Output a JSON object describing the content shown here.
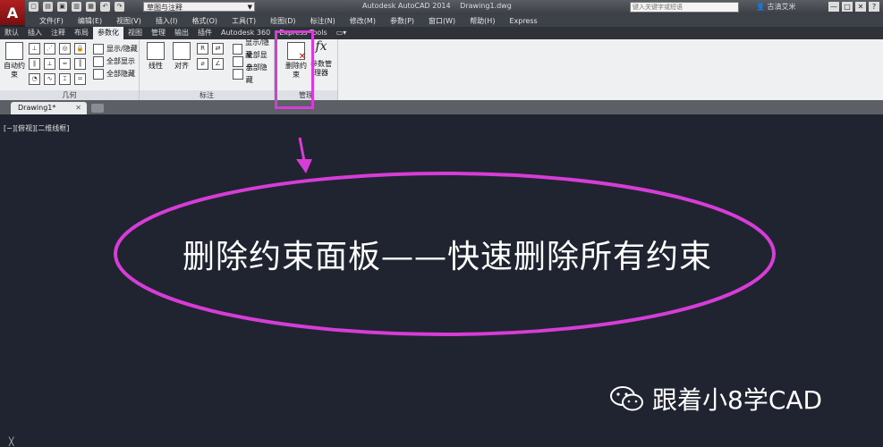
{
  "titlebar": {
    "app_letter": "A",
    "workspace": "草图与注释",
    "title_app": "Autodesk AutoCAD 2014",
    "title_file": "Drawing1.dwg",
    "search_placeholder": "键入关键字或短语",
    "user": "古滇艾米",
    "window_controls": [
      "—",
      "□",
      "✕"
    ],
    "help": "?"
  },
  "menubar": {
    "items": [
      "文件(F)",
      "编辑(E)",
      "视图(V)",
      "插入(I)",
      "格式(O)",
      "工具(T)",
      "绘图(D)",
      "标注(N)",
      "修改(M)",
      "参数(P)",
      "窗口(W)",
      "帮助(H)",
      "Express"
    ]
  },
  "ribbon_tabs": {
    "items": [
      "默认",
      "插入",
      "注释",
      "布局",
      "参数化",
      "视图",
      "管理",
      "输出",
      "插件",
      "Autodesk 360",
      "Express Tools"
    ],
    "active_index": 4
  },
  "ribbon": {
    "geometry": {
      "title": "几何",
      "auto_constrain": "自动约束",
      "show_hide": "显示/隐藏",
      "show_all": "全部显示",
      "hide_all": "全部隐藏"
    },
    "dimension": {
      "title": "标注",
      "linear": "线性",
      "aligned": "对齐",
      "show_hide": "显示/隐藏",
      "show_all": "全部显示",
      "hide_all": "全部隐藏"
    },
    "manage": {
      "title": "管理",
      "delete_constraints": "删除约束",
      "param_manager": "参数管理器",
      "fx": "fx"
    }
  },
  "filetabs": {
    "current": "Drawing1*",
    "close": "✕"
  },
  "canvas": {
    "viewport_label": "[−][俯视][二维线框]",
    "caption": "删除约束面板——快速删除所有约束",
    "watermark": "跟着小8学CAD"
  },
  "colors": {
    "highlight": "#d63cd6",
    "canvas_bg": "#1f2430"
  }
}
